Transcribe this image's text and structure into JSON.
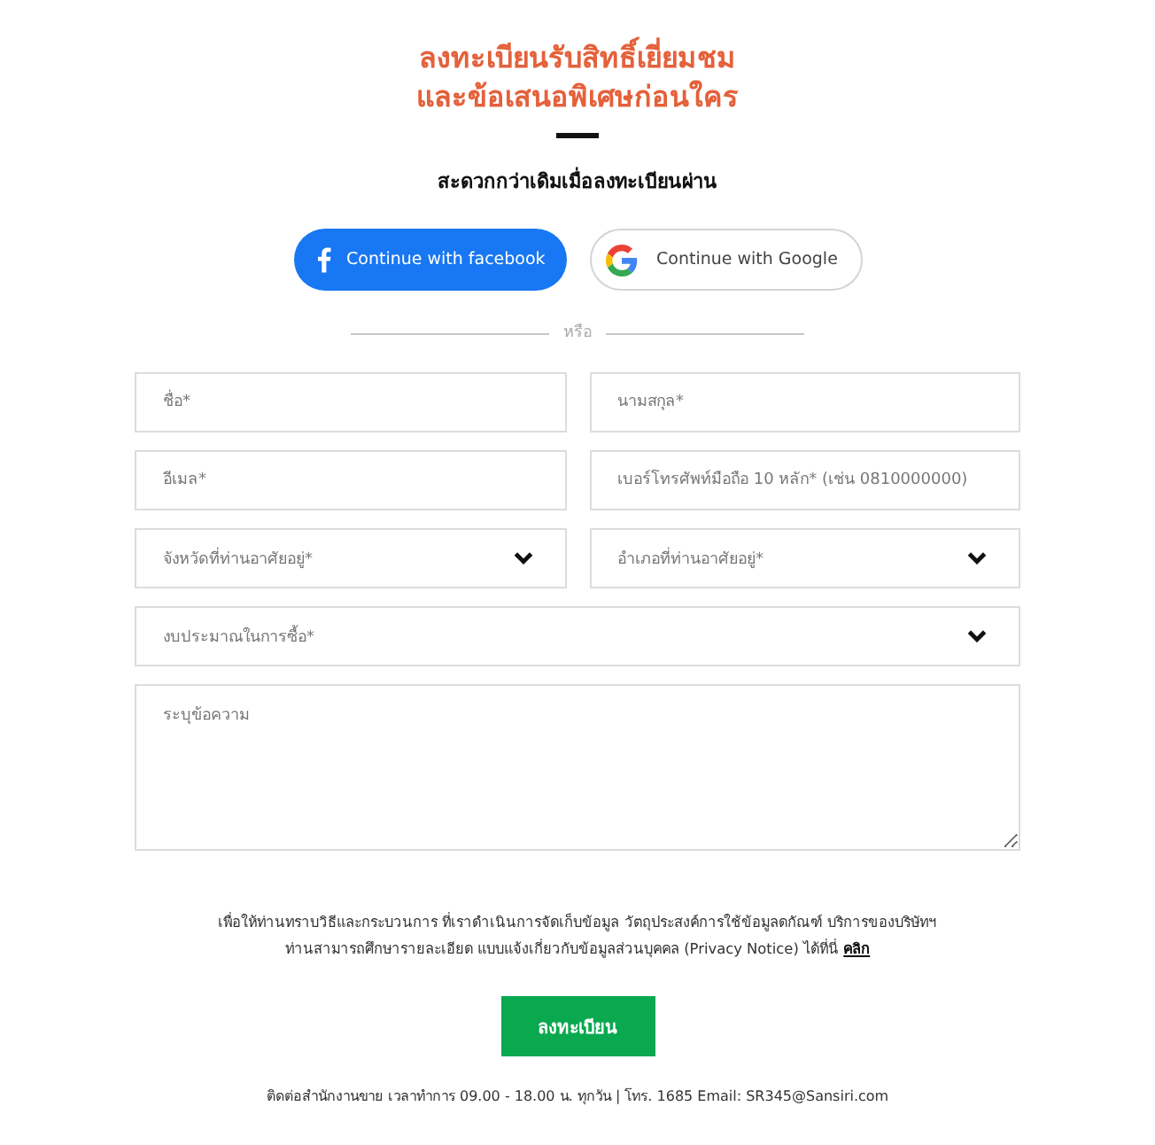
{
  "heading": {
    "lines": [
      "ลงทะเบียนรับสิทธิ์เยี่ยมชม",
      "และข้อเสนอพิเศษก่อนใคร"
    ]
  },
  "subheading": "สะดวกกว่าเดิมเมื่อลงทะเบียนผ่าน",
  "social_buttons": [
    {
      "kind": "facebook",
      "label": "Continue with facebook"
    },
    {
      "kind": "google",
      "label": "Continue with Google"
    }
  ],
  "separator": "หรือ",
  "form_rows": [
    [
      {
        "kind": "input",
        "placeholder": "ชื่อ*"
      },
      {
        "kind": "input",
        "placeholder": "นามสกุล*"
      }
    ],
    [
      {
        "kind": "input",
        "placeholder": "อีเมล*"
      },
      {
        "kind": "input",
        "placeholder": "เบอร์โทรศัพท์มือถือ 10 หลัก* (เช่น 0810000000)"
      }
    ],
    [
      {
        "kind": "select",
        "placeholder": "จังหวัดที่ท่านอาศัยอยู่*"
      },
      {
        "kind": "select",
        "placeholder": "อำเภอที่ท่านอาศัยอยู่*"
      }
    ],
    [
      {
        "kind": "select",
        "placeholder": "งบประมาณในการซื้อ*"
      }
    ],
    [
      {
        "kind": "textarea",
        "placeholder": "ระบุข้อความ"
      }
    ]
  ],
  "privacy_notice": {
    "text": "เพื่อให้ท่านทราบวิธีและกระบวนการ ที่เราดำเนินการจัดเก็บข้อมูล วัตถุประสงค์การใช้ข้อมูลดกัณฑ์ บริการของบริษัทฯ ท่านสามารถศึกษารายละเอียด แบบแจ้งเกี่ยวกับข้อมูลส่วนบุคคล (Privacy Notice) ได้ที่นี่",
    "link": "คลิก"
  },
  "submit_button": "ลงทะเบียน",
  "contact": "ติดต่อสำนักงานขาย เวลาทำการ 09.00 - 18.00 น. ทุกวัน | โทร. 1685 Email: SR345@Sansiri.com"
}
